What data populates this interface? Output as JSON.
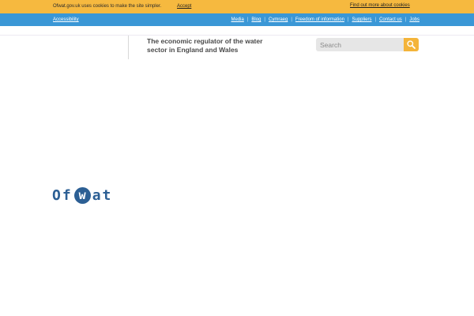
{
  "cookie_banner": {
    "message": "Ofwat.gov.uk uses cookies to make the site simpler.",
    "accept_label": "Accept",
    "more_label": "Find out more about cookies"
  },
  "nav": {
    "accessibility_label": "Accessibility",
    "links": [
      {
        "label": "Media"
      },
      {
        "label": "Blog"
      },
      {
        "label": "Cymraeg"
      },
      {
        "label": "Freedom of information"
      },
      {
        "label": "Suppliers"
      },
      {
        "label": "Contact us"
      },
      {
        "label": "Jobs"
      }
    ]
  },
  "header": {
    "tagline": "The economic regulator of the water sector in England and Wales"
  },
  "search": {
    "placeholder": "Search",
    "icon": "magnifier-icon"
  },
  "logo": {
    "prefix": "Of",
    "circled": "w",
    "suffix": "at"
  },
  "colors": {
    "cookie_bar": "#f6b93f",
    "nav_bar": "#3a97d6",
    "logo": "#2c5f94",
    "search_button": "#f4b43a"
  }
}
